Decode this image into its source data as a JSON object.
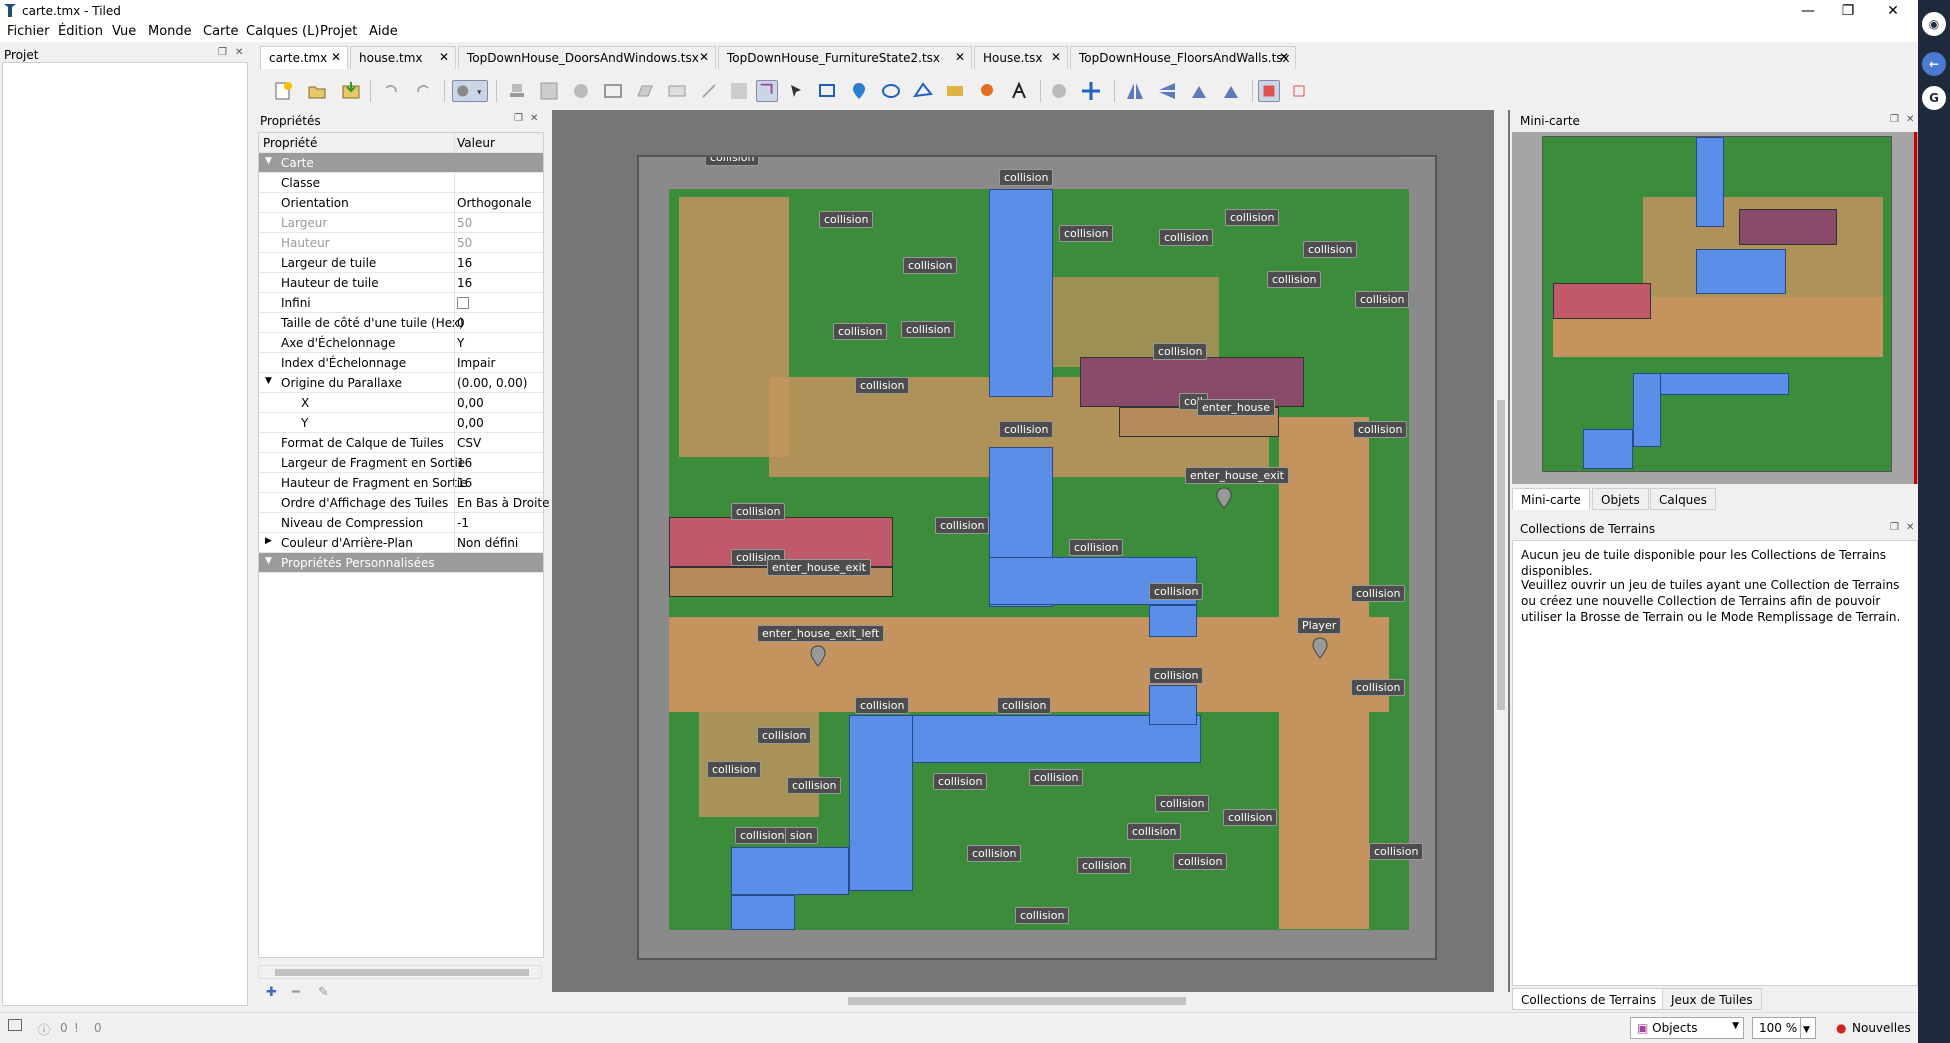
{
  "window": {
    "title": "carte.tmx - Tiled",
    "minimize": "—",
    "maximize": "❐",
    "close": "✕"
  },
  "menu": [
    "Fichier",
    "Édition",
    "Vue",
    "Monde",
    "Carte",
    "Calques (L)",
    "Projet",
    "Aide"
  ],
  "projet": {
    "title": "Projet"
  },
  "tabs": [
    {
      "label": "carte.tmx",
      "active": true
    },
    {
      "label": "house.tmx"
    },
    {
      "label": "TopDownHouse_DoorsAndWindows.tsx"
    },
    {
      "label": "TopDownHouse_FurnitureState2.tsx"
    },
    {
      "label": "House.tsx"
    },
    {
      "label": "TopDownHouse_FloorsAndWalls.tsx"
    }
  ],
  "properties": {
    "title": "Propriétés",
    "col_name": "Propriété",
    "col_value": "Valeur",
    "rows": [
      {
        "k": "Carte",
        "v": "",
        "group": true
      },
      {
        "k": "Classe",
        "v": ""
      },
      {
        "k": "Orientation",
        "v": "Orthogonale"
      },
      {
        "k": "Largeur",
        "v": "50",
        "dim": true
      },
      {
        "k": "Hauteur",
        "v": "50",
        "dim": true
      },
      {
        "k": "Largeur de tuile",
        "v": "16"
      },
      {
        "k": "Hauteur de tuile",
        "v": "16"
      },
      {
        "k": "Infini",
        "v": "",
        "checkbox": true
      },
      {
        "k": "Taille de côté d'une tuile (Hex)",
        "v": "0"
      },
      {
        "k": "Axe d'Échelonnage",
        "v": "Y"
      },
      {
        "k": "Index d'Échelonnage",
        "v": "Impair"
      },
      {
        "k": "Origine du Parallaxe",
        "v": "(0.00, 0.00)",
        "expand": "open"
      },
      {
        "k": "X",
        "v": "0,00",
        "indent": true
      },
      {
        "k": "Y",
        "v": "0,00",
        "indent": true
      },
      {
        "k": "Format de Calque de Tuiles",
        "v": "CSV"
      },
      {
        "k": "Largeur de Fragment en Sortie",
        "v": "16"
      },
      {
        "k": "Hauteur de Fragment en Sortie",
        "v": "16"
      },
      {
        "k": "Ordre d'Affichage des Tuiles",
        "v": "En Bas à Droite"
      },
      {
        "k": "Niveau de Compression",
        "v": "-1"
      },
      {
        "k": "Couleur d'Arrière-Plan",
        "v": "Non défini",
        "expand": "closed"
      },
      {
        "k": "Propriétés Personnalisées",
        "v": "",
        "group": true
      }
    ]
  },
  "map": {
    "collision_label": "collision",
    "enter_house": "enter_house",
    "enter_house_exit": "enter_house_exit",
    "enter_house_exit_left": "enter_house_exit_left",
    "player": "Player",
    "partial_collision": "coll",
    "partial_sion": "sion"
  },
  "minimap": {
    "title": "Mini-carte",
    "tabs": [
      "Mini-carte",
      "Objets",
      "Calques"
    ]
  },
  "terrains": {
    "title": "Collections de Terrains",
    "msg1": "Aucun jeu de tuile disponible pour les Collections de Terrains disponibles.",
    "msg2": "Veuillez ouvrir un jeu de tuiles ayant une Collection de Terrains ou créez une nouvelle Collection de Terrains afin de pouvoir utiliser la Brosse de Terrain ou le Mode Remplissage de Terrain."
  },
  "bottom_tabs": [
    "Collections de Terrains",
    "Jeux de Tuiles"
  ],
  "status": {
    "errors": "0",
    "warnings": "0",
    "layer": "Objects",
    "zoom": "100 %",
    "news": "Nouvelles"
  },
  "colors": {
    "grass": "#3c8d3b",
    "dirt": "#c4935e",
    "water": "#5a8ee8",
    "wall": "#8a8a8a",
    "roof": "#8a4a6a"
  }
}
